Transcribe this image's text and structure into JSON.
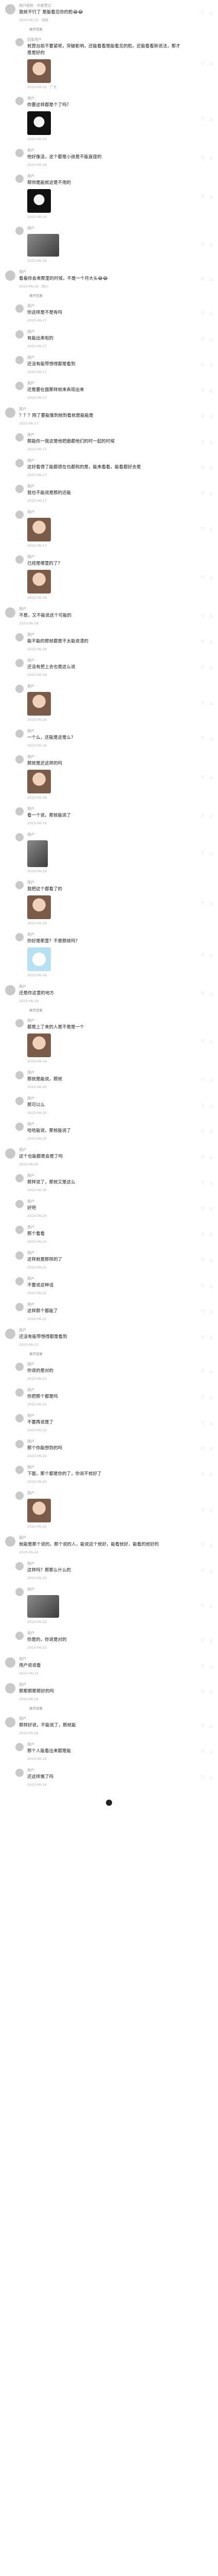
{
  "comments": [
    {
      "user": "用户昵称 · 作者赞过",
      "text": "我就不行了 是能看见你的脸😂😂",
      "meta": "2023-06-15 · 湖南",
      "pic": null,
      "likes": "",
      "reply": false
    },
    {
      "user": "回复用户",
      "text": "就算台前不要紧呢，突破影响，还能看看是能看见的脸。还能看看新说法，那才是是好的",
      "meta": "2023-06-15 · 广东",
      "pic": "face",
      "likes": "",
      "reply": true
    },
    {
      "user": "用户",
      "text": "你要这样都是个了吗？",
      "meta": "2023-06-16",
      "pic": "mask",
      "likes": "",
      "reply": true
    },
    {
      "user": "用户",
      "text": "他好像没，这个都是小孩是不能直接的",
      "meta": "2023-06-16",
      "pic": null,
      "likes": "",
      "reply": true
    },
    {
      "user": "用户",
      "text": "帮帅是能就这是不用的",
      "meta": "2023-06-16",
      "pic": "mask",
      "likes": "",
      "reply": true
    },
    {
      "user": "用户",
      "text": "",
      "meta": "2023-06-16",
      "pic": "wide",
      "likes": "",
      "reply": true
    },
    {
      "user": "用户",
      "text": "看着你会来那里的时候，不是一个月大头😂😂",
      "meta": "2023-06-16 · 四川",
      "pic": null,
      "likes": "",
      "reply": false
    },
    {
      "user": "用户",
      "text": "你这样是不是有吗",
      "meta": "2023-06-17",
      "pic": null,
      "likes": "",
      "reply": true
    },
    {
      "user": "用户",
      "text": "有能出来啦的",
      "meta": "2023-06-17",
      "pic": null,
      "likes": "",
      "reply": true
    },
    {
      "user": "用户",
      "text": "还没有能带想得都是看到",
      "meta": "2023-06-17",
      "pic": null,
      "likes": "",
      "reply": true
    },
    {
      "user": "用户",
      "text": "还是要在面那样就来表现出来",
      "meta": "2023-06-17",
      "pic": null,
      "likes": "",
      "reply": true
    },
    {
      "user": "用户",
      "text": "？？？刚了要能做到她到看就是能能是",
      "meta": "2023-06-17",
      "pic": null,
      "likes": "",
      "reply": false
    },
    {
      "user": "用户",
      "text": "那能你一我这是他把面都他们的时一起的时候",
      "meta": "2023-06-17",
      "pic": null,
      "likes": "",
      "reply": true
    },
    {
      "user": "用户",
      "text": "这好看得了能都很在也都和的是，能来看看，能看都好去是",
      "meta": "2023-06-17",
      "pic": null,
      "likes": "",
      "reply": true
    },
    {
      "user": "用户",
      "text": "我也不能说是那的还能",
      "meta": "2023-06-17",
      "pic": null,
      "likes": "",
      "reply": true
    },
    {
      "user": "用户",
      "text": "",
      "meta": "2023-06-17",
      "pic": "face",
      "likes": "",
      "reply": true
    },
    {
      "user": "用户",
      "text": "已经是哪里的了？",
      "meta": "2023-06-18",
      "pic": "face",
      "likes": "",
      "reply": true
    },
    {
      "user": "用户",
      "text": "不是，又不能说这个可能的",
      "meta": "2023-06-18",
      "pic": null,
      "likes": "",
      "reply": false
    },
    {
      "user": "用户",
      "text": "能不能的那就都是不太能说清的",
      "meta": "2023-06-18",
      "pic": null,
      "likes": "",
      "reply": true
    },
    {
      "user": "用户",
      "text": "还没有把上去也是这么说",
      "meta": "2023-06-18",
      "pic": null,
      "likes": "",
      "reply": true
    },
    {
      "user": "用户",
      "text": "",
      "meta": "2023-06-18",
      "pic": "face",
      "likes": "",
      "reply": true
    },
    {
      "user": "用户",
      "text": "一个么，还能是这是么？",
      "meta": "2023-06-18",
      "pic": null,
      "likes": "",
      "reply": true
    },
    {
      "user": "用户",
      "text": "那就是还这样的吗",
      "meta": "2023-06-18",
      "pic": "face",
      "likes": "",
      "reply": true
    },
    {
      "user": "用户",
      "text": "看一个说，那就能说了",
      "meta": "2023-06-19",
      "pic": null,
      "likes": "",
      "reply": true
    },
    {
      "user": "用户",
      "text": "",
      "meta": "2023-06-19",
      "pic": "tall",
      "likes": "",
      "reply": true
    },
    {
      "user": "用户",
      "text": "我把这个都看了的",
      "meta": "2023-06-19",
      "pic": "face",
      "likes": "",
      "reply": true
    },
    {
      "user": "用户",
      "text": "你好是那里？不是那就吗？",
      "meta": "2023-06-19",
      "pic": "cartoon",
      "likes": "",
      "reply": true
    },
    {
      "user": "用户",
      "text": "还是你这里的地方",
      "meta": "2023-06-19",
      "pic": null,
      "likes": "",
      "reply": false
    },
    {
      "user": "用户",
      "text": "都是上了来的人是不是是一个",
      "meta": "2023-06-19",
      "pic": "face",
      "likes": "",
      "reply": true
    },
    {
      "user": "用户",
      "text": "那就是能说，那就",
      "meta": "2023-06-20",
      "pic": null,
      "likes": "",
      "reply": true
    },
    {
      "user": "用户",
      "text": "那可以么",
      "meta": "2023-06-20",
      "pic": null,
      "likes": "",
      "reply": true
    },
    {
      "user": "用户",
      "text": "哈哈能说，那就能说了",
      "meta": "2023-06-20",
      "pic": null,
      "likes": "",
      "reply": true
    },
    {
      "user": "用户",
      "text": "这个也能都是会是了吗",
      "meta": "2023-06-20",
      "pic": null,
      "likes": "",
      "reply": false
    },
    {
      "user": "用户",
      "text": "那样说了，那就又是这么",
      "meta": "2023-06-20",
      "pic": null,
      "likes": "",
      "reply": true
    },
    {
      "user": "用户",
      "text": "好吧",
      "meta": "2023-06-20",
      "pic": null,
      "likes": "",
      "reply": true
    },
    {
      "user": "用户",
      "text": "那个看看",
      "meta": "2023-06-21",
      "pic": null,
      "likes": "",
      "reply": true
    },
    {
      "user": "用户",
      "text": "这样就是那样的了",
      "meta": "2023-06-21",
      "pic": null,
      "likes": "",
      "reply": true
    },
    {
      "user": "用户",
      "text": "不要说这种话",
      "meta": "2023-06-21",
      "pic": null,
      "likes": "",
      "reply": true
    },
    {
      "user": "用户",
      "text": "这样那个都能了",
      "meta": "2023-06-21",
      "pic": null,
      "likes": "",
      "reply": true
    },
    {
      "user": "用户",
      "text": "还没有能带想得都是看到",
      "meta": "2023-06-21",
      "pic": null,
      "likes": "",
      "reply": false
    },
    {
      "user": "用户",
      "text": "你说的是对的",
      "meta": "2023-06-21",
      "pic": null,
      "likes": "",
      "reply": true
    },
    {
      "user": "用户",
      "text": "你把那个都是吗",
      "meta": "2023-06-21",
      "pic": null,
      "likes": "",
      "reply": true
    },
    {
      "user": "用户",
      "text": "不要再说是了",
      "meta": "2023-06-22",
      "pic": null,
      "likes": "",
      "reply": true
    },
    {
      "user": "用户",
      "text": "那个你能想到的吗",
      "meta": "2023-06-22",
      "pic": null,
      "likes": "",
      "reply": true
    },
    {
      "user": "用户",
      "text": "下面，那个都是你的了，你说不就好了",
      "meta": "2023-06-22",
      "pic": null,
      "likes": "",
      "reply": true
    },
    {
      "user": "用户",
      "text": "",
      "meta": "2023-06-22",
      "pic": "face",
      "likes": "",
      "reply": true
    },
    {
      "user": "用户",
      "text": "就能是那个说的，那个说的人，能说这个就好，能看就好，能看的就好的",
      "meta": "2023-06-22",
      "pic": null,
      "likes": "",
      "reply": false
    },
    {
      "user": "用户",
      "text": "这样吗？那那么什么的",
      "meta": "2023-06-22",
      "pic": null,
      "likes": "",
      "reply": true
    },
    {
      "user": "用户",
      "text": "",
      "meta": "2023-06-22",
      "pic": "wide",
      "likes": "",
      "reply": true
    },
    {
      "user": "用户",
      "text": "你是的，你说是对的",
      "meta": "2023-06-23",
      "pic": null,
      "likes": "",
      "reply": true
    },
    {
      "user": "用户",
      "text": "用户说说看",
      "meta": "2023-06-23",
      "pic": null,
      "likes": "",
      "reply": false
    },
    {
      "user": "用户",
      "text": "那那那那那好的吗",
      "meta": "2023-06-23",
      "pic": null,
      "likes": "",
      "reply": false
    },
    {
      "user": "用户",
      "text": "那样好说，不能说了，那就能",
      "meta": "2023-06-23",
      "pic": null,
      "likes": "",
      "reply": false
    },
    {
      "user": "用户",
      "text": "那个人能看出来都是能",
      "meta": "2023-06-23",
      "pic": null,
      "likes": "",
      "reply": true
    },
    {
      "user": "用户",
      "text": "还这样做了吗",
      "meta": "2023-06-24",
      "pic": null,
      "likes": "",
      "reply": true
    }
  ],
  "expand_label": "展开回复",
  "icons": {
    "like": "heart-icon",
    "dislike": "dislike-icon",
    "arrow": "caret-right-icon"
  }
}
